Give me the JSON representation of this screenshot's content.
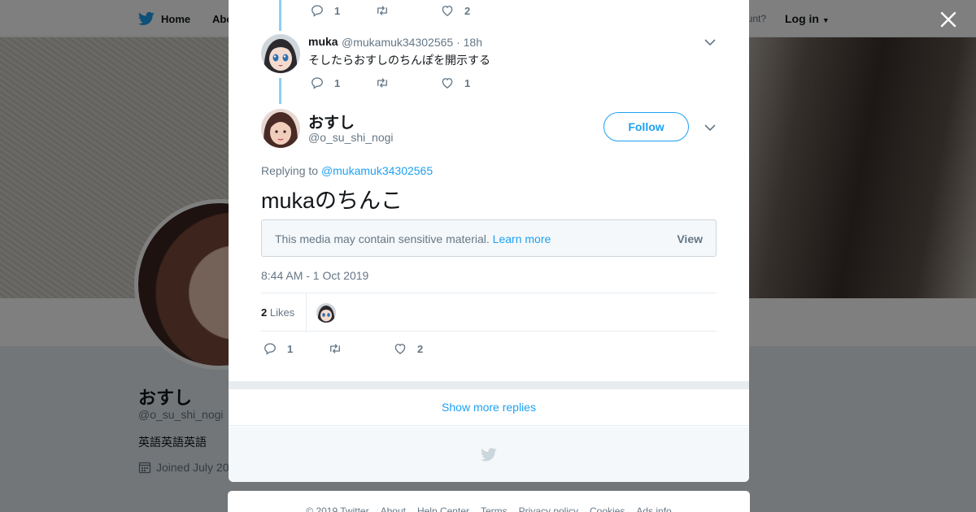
{
  "topbar": {
    "home": "Home",
    "about": "Abo",
    "account": "ccount?",
    "login": "Log in"
  },
  "profile": {
    "name": "おすし",
    "handle": "@o_su_shi_nogi",
    "bio": "英語英語英語",
    "joined": "Joined July 20"
  },
  "top_actions": {
    "replies": "1",
    "retweets": "",
    "likes": "2"
  },
  "reply_tweet": {
    "name": "muka",
    "handle": "@mukamuk34302565",
    "time": "18h",
    "text": "そしたらおすしのちんぽを開示する",
    "replies": "1",
    "likes": "1"
  },
  "main_tweet": {
    "name": "おすし",
    "handle": "@o_su_shi_nogi",
    "follow_label": "Follow",
    "replying_label": "Replying to",
    "replying_to": "@mukamuk34302565",
    "text": "mukaのちんこ",
    "sensitive_text": "This media may contain sensitive material.",
    "learn_more": "Learn more",
    "view_label": "View",
    "timestamp": "8:44 AM - 1 Oct 2019",
    "likes_count": "2",
    "likes_label": "Likes",
    "replies": "1",
    "likes": "2"
  },
  "show_more": "Show more replies",
  "footer": {
    "links": [
      "© 2019 Twitter",
      "About",
      "Help Center",
      "Terms",
      "Privacy policy",
      "Cookies",
      "Ads info"
    ]
  },
  "colors": {
    "accent": "#1da1f2",
    "thread_line": "#8ecdf8",
    "muted": "#657786"
  }
}
